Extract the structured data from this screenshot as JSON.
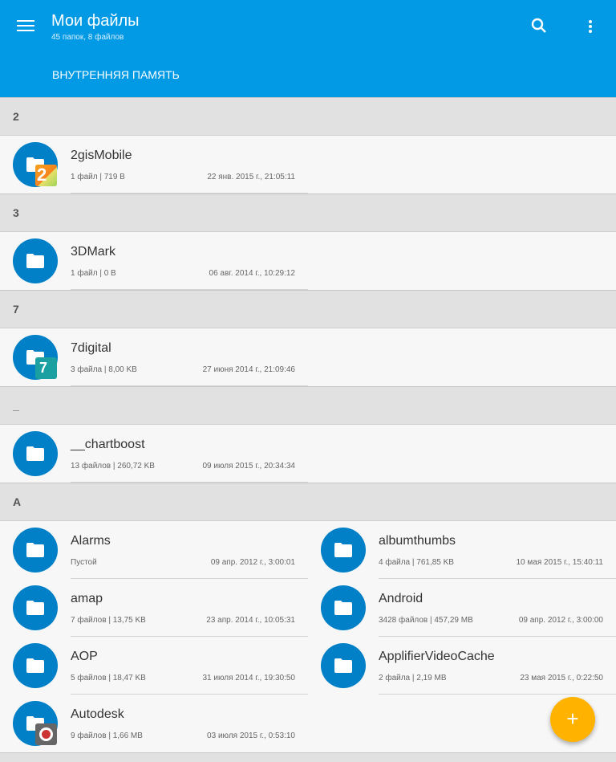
{
  "appbar": {
    "title": "Мои файлы",
    "subtitle": "45 папок, 8 файлов",
    "tab": "ВНУТРЕННЯЯ ПАМЯТЬ",
    "icons": {
      "menu": "menu-icon",
      "search": "search-icon",
      "more": "more-vert-icon"
    },
    "color": "#029ae4"
  },
  "sections": [
    {
      "letter": "2"
    },
    {
      "letter": "3"
    },
    {
      "letter": "7"
    },
    {
      "letter": "_"
    },
    {
      "letter": "A"
    }
  ],
  "items": [
    {
      "name": "2gisMobile",
      "meta": "1 файл  |  719 B",
      "date": "22 янв. 2015 г., 21:05:11",
      "badge": "2gis"
    },
    {
      "name": "3DMark",
      "meta": "1 файл  |  0 B",
      "date": "06 авг. 2014 г., 10:29:12"
    },
    {
      "name": "7digital",
      "meta": "3 файла  |  8,00 KB",
      "date": "27 июня 2014 г., 21:09:46",
      "badge": "7digital"
    },
    {
      "name": "__chartboost",
      "meta": "13 файлов  |  260,72 KB",
      "date": "09 июля 2015 г., 20:34:34"
    },
    {
      "name": "Alarms",
      "meta": "Пустой",
      "date": "09 апр. 2012 г., 3:00:01"
    },
    {
      "name": "albumthumbs",
      "meta": "4 файла  |  761,85 KB",
      "date": "10 мая 2015 г., 15:40:11"
    },
    {
      "name": "amap",
      "meta": "7 файлов  |  13,75 KB",
      "date": "23 апр. 2014 г., 10:05:31"
    },
    {
      "name": "Android",
      "meta": "3428 файлов  |  457,29 MB",
      "date": "09 апр. 2012 г., 3:00:00"
    },
    {
      "name": "AOP",
      "meta": "5 файлов  |  18,47 KB",
      "date": "31 июля 2014 г., 19:30:50"
    },
    {
      "name": "ApplifierVideoCache",
      "meta": "2 файла  |  2,19 MB",
      "date": "23 мая 2015 г., 0:22:50"
    },
    {
      "name": "Autodesk",
      "meta": "9 файлов  |  1,66 MB",
      "date": "03 июля 2015 г., 0:53:10",
      "badge": "autodesk"
    }
  ],
  "fab": {
    "symbol": "+",
    "color": "#ffb300"
  },
  "colors": {
    "folder": "#0180c7",
    "header": "#e1e1e1"
  }
}
